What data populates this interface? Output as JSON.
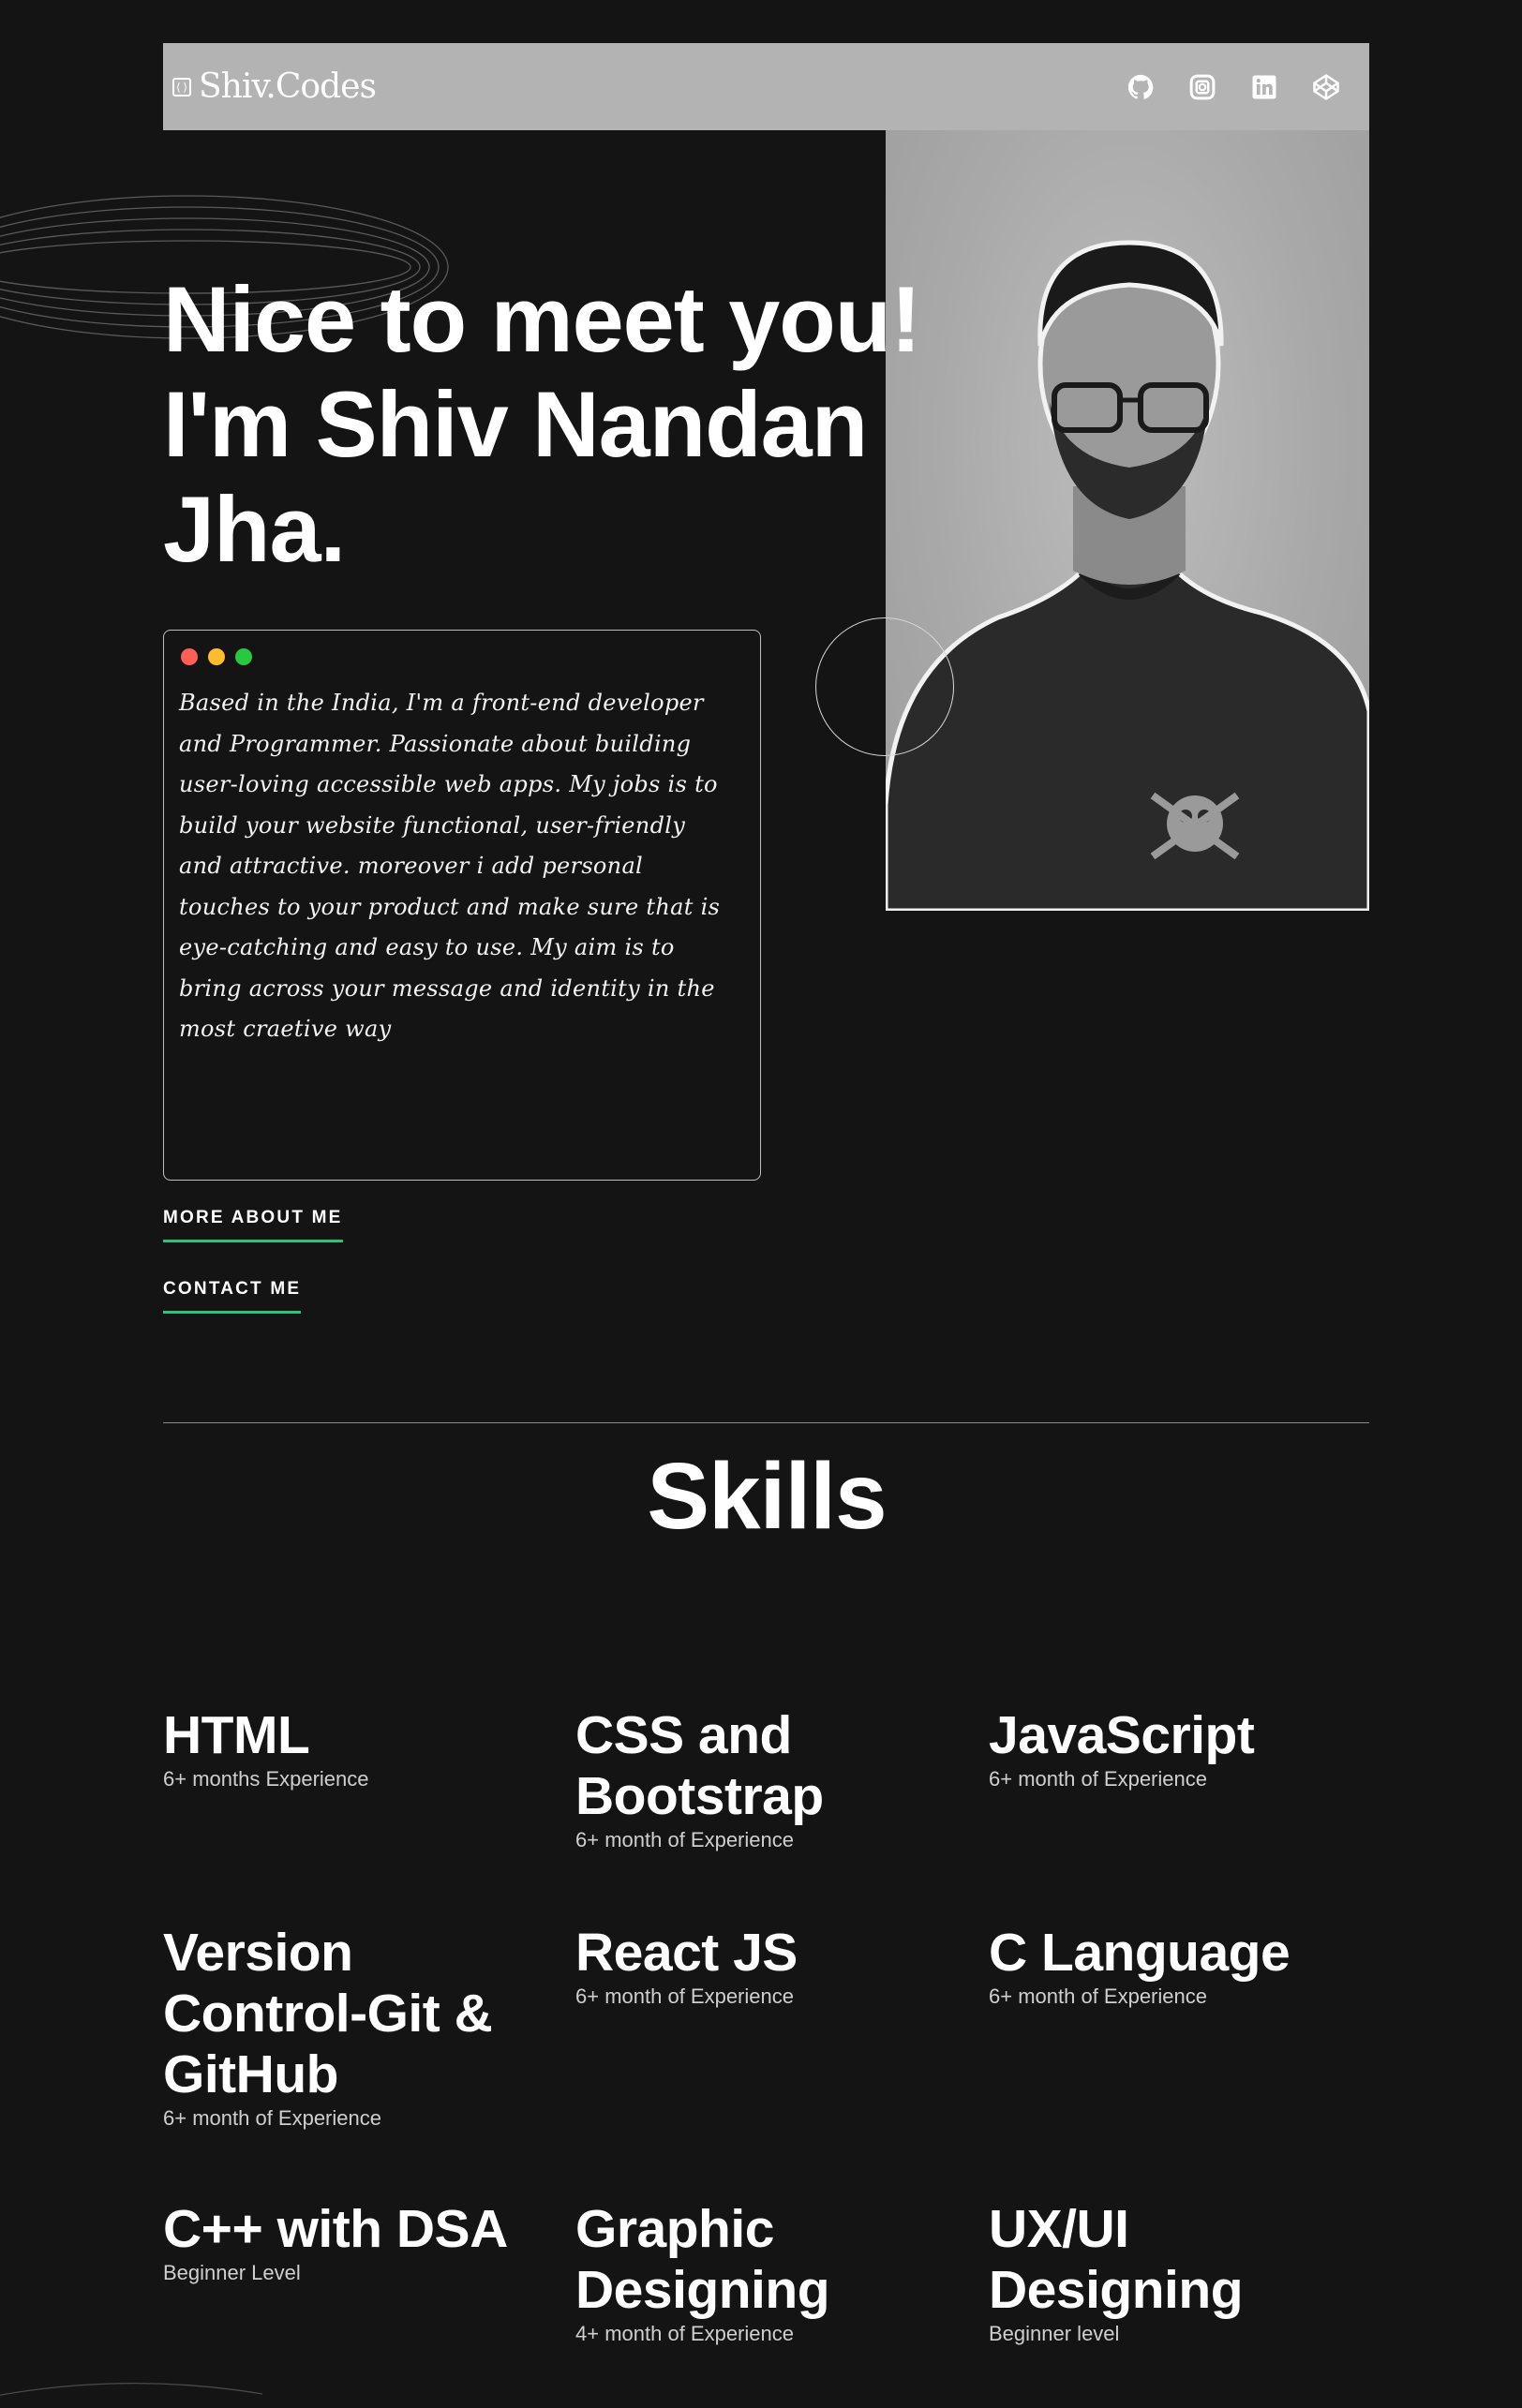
{
  "header": {
    "brand": "Shiv.Codes",
    "socials": [
      {
        "name": "github-icon"
      },
      {
        "name": "instagram-icon"
      },
      {
        "name": "linkedin-icon"
      },
      {
        "name": "codepen-icon"
      }
    ]
  },
  "hero": {
    "title_line1": "Nice to meet you!",
    "title_line2": "I'm Shiv Nandan",
    "title_line3": "Jha.",
    "bio": "Based in the India, I'm a front-end developer and Programmer. Passionate about building user-loving accessible web apps. My jobs is to build your website functional, user-friendly and attractive. moreover i add personal touches to your product and make sure that is eye-catching and easy to use. My aim is to bring across your message and identity in the most craetive way",
    "dots": [
      "#ff5f56",
      "#ffbd2e",
      "#27c93f"
    ]
  },
  "links": {
    "about": "MORE ABOUT ME",
    "contact": "CONTACT ME",
    "accent": "#2ec27e"
  },
  "skills": {
    "title": "Skills",
    "items": [
      {
        "name": "HTML",
        "exp": "6+ months Experience"
      },
      {
        "name": "CSS and Bootstrap",
        "exp": "6+ month of Experience"
      },
      {
        "name": "JavaScript",
        "exp": "6+ month of Experience"
      },
      {
        "name": "Version Control-Git & GitHub",
        "exp": "6+ month of Experience"
      },
      {
        "name": "React JS",
        "exp": "6+ month of Experience"
      },
      {
        "name": "C Language",
        "exp": "6+ month of Experience"
      },
      {
        "name": "C++ with DSA",
        "exp": "Beginner Level"
      },
      {
        "name": "Graphic Designing",
        "exp": "4+ month of Experience"
      },
      {
        "name": "UX/UI Designing",
        "exp": "Beginner level"
      }
    ]
  }
}
